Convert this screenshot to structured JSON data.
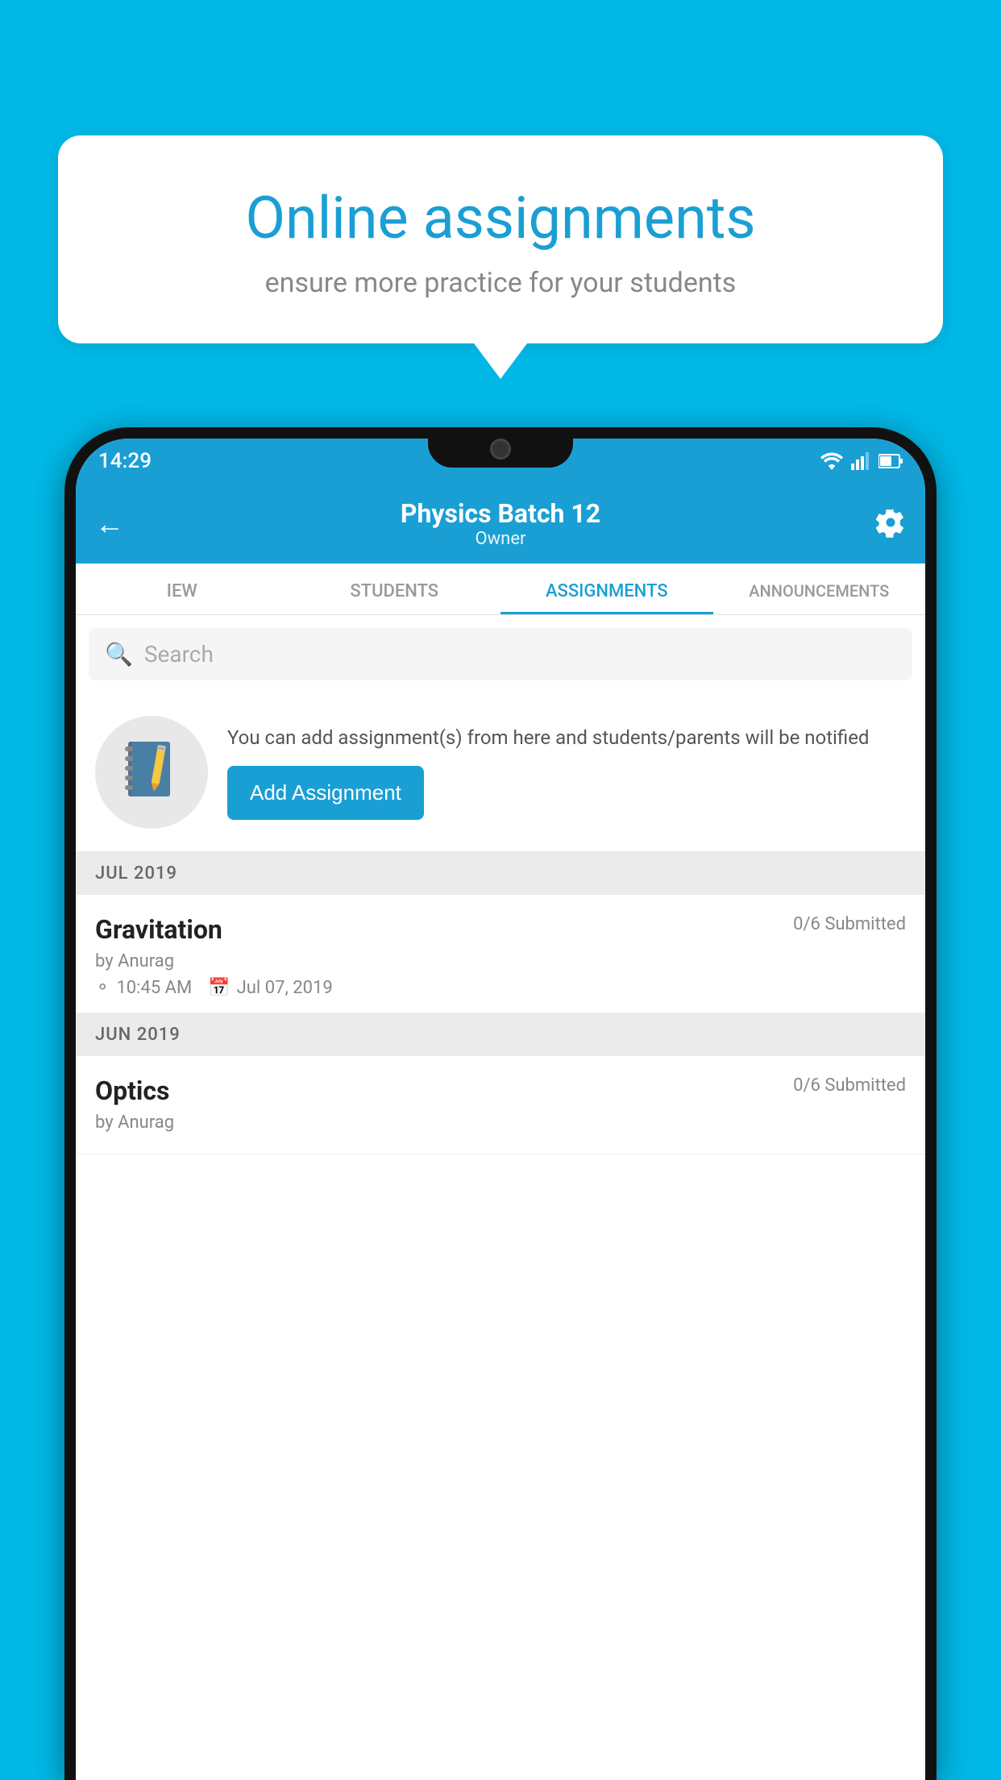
{
  "background_color": "#00b8e6",
  "speech_bubble": {
    "title": "Online assignments",
    "subtitle": "ensure more practice for your students"
  },
  "status_bar": {
    "time": "14:29"
  },
  "app_header": {
    "title": "Physics Batch 12",
    "subtitle": "Owner"
  },
  "tabs": [
    {
      "id": "iew",
      "label": "IEW",
      "active": false
    },
    {
      "id": "students",
      "label": "STUDENTS",
      "active": false
    },
    {
      "id": "assignments",
      "label": "ASSIGNMENTS",
      "active": true
    },
    {
      "id": "announcements",
      "label": "ANNOUNCEMENTS",
      "active": false
    }
  ],
  "search": {
    "placeholder": "Search"
  },
  "promo": {
    "description": "You can add assignment(s) from here and students/parents will be notified",
    "button_label": "Add Assignment"
  },
  "sections": [
    {
      "label": "JUL 2019",
      "assignments": [
        {
          "name": "Gravitation",
          "submitted": "0/6 Submitted",
          "by": "by Anurag",
          "time": "10:45 AM",
          "date": "Jul 07, 2019"
        }
      ]
    },
    {
      "label": "JUN 2019",
      "assignments": [
        {
          "name": "Optics",
          "submitted": "0/6 Submitted",
          "by": "by Anurag",
          "time": "",
          "date": ""
        }
      ]
    }
  ]
}
